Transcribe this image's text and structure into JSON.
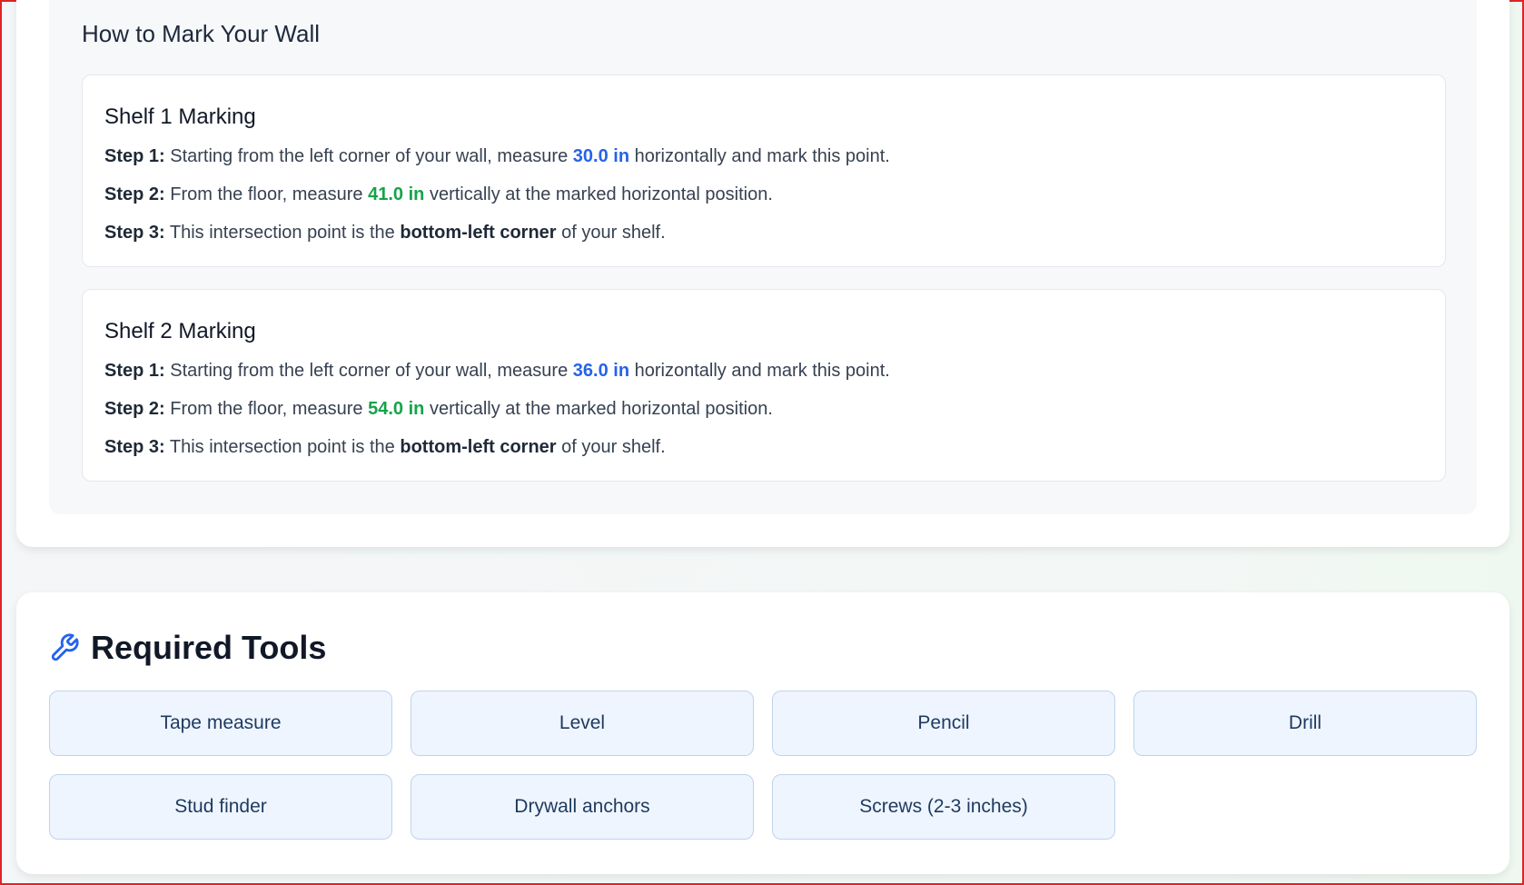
{
  "marking": {
    "title": "How to Mark Your Wall",
    "shelves": [
      {
        "title": "Shelf 1 Marking",
        "steps": [
          {
            "label": "Step 1:",
            "pre": "Starting from the left corner of your wall, measure",
            "value": "30.0 in",
            "post": "horizontally and mark this point."
          },
          {
            "label": "Step 2:",
            "pre": "From the floor, measure",
            "value": "41.0 in",
            "post": "vertically at the marked horizontal position."
          },
          {
            "label": "Step 3:",
            "pre": "This intersection point is the",
            "value": "bottom-left corner",
            "post": "of your shelf."
          }
        ]
      },
      {
        "title": "Shelf 2 Marking",
        "steps": [
          {
            "label": "Step 1:",
            "pre": "Starting from the left corner of your wall, measure",
            "value": "36.0 in",
            "post": "horizontally and mark this point."
          },
          {
            "label": "Step 2:",
            "pre": "From the floor, measure",
            "value": "54.0 in",
            "post": "vertically at the marked horizontal position."
          },
          {
            "label": "Step 3:",
            "pre": "This intersection point is the",
            "value": "bottom-left corner",
            "post": "of your shelf."
          }
        ]
      }
    ]
  },
  "tools": {
    "icon": "wrench-icon",
    "title": "Required Tools",
    "items": [
      "Tape measure",
      "Level",
      "Pencil",
      "Drill",
      "Stud finder",
      "Drywall anchors",
      "Screws (2-3 inches)"
    ]
  },
  "colors": {
    "horizontal_value": "#2563eb",
    "vertical_value": "#16a34a",
    "tool_bg": "#eef5fe"
  }
}
